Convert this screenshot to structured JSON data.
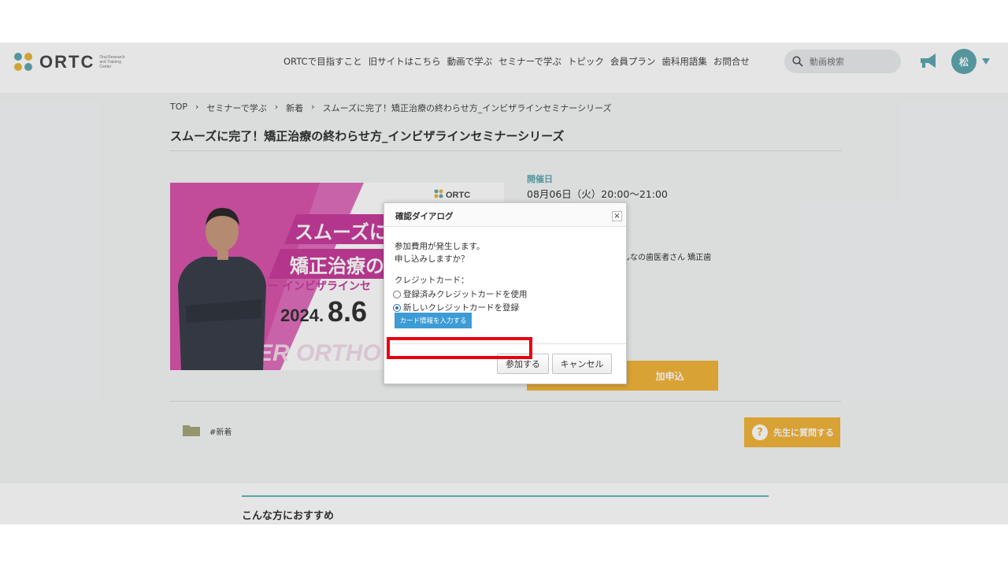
{
  "header": {
    "logo_text": "ORTC",
    "logo_sub": "Oral Research and Training Center",
    "nav": [
      "ORTCで目指すこと",
      "旧サイトはこちら",
      "動画で学ぶ",
      "セミナーで学ぶ",
      "トピック",
      "会員プラン",
      "歯科用語集",
      "お問合せ"
    ],
    "search_placeholder": "動画検索",
    "avatar_initial": "松"
  },
  "breadcrumb": [
    "TOP",
    "›",
    "セミナーで学ぶ",
    "›",
    "新着",
    "›",
    "スムーズに完了！矯正治療の終わらせ方_インビザラインセミナーシリーズ"
  ],
  "page_title": "スムーズに完了！矯正治療の終わらせ方_インビザラインセミナーシリーズ",
  "banner": {
    "line1": "スムーズに",
    "line2": "矯正治療の",
    "line3": "ー インビザラインセ",
    "date": "2024.",
    "date_big": "8.6",
    "logo": "ORTC",
    "watermark": "ER ORTHO"
  },
  "event": {
    "date_label": "開催日",
    "date_value": "08月06日（火）20:00～21:00",
    "desc_fragment": "んなの歯医者さん 矯正歯",
    "apply_label": "加申込"
  },
  "tag": "#新着",
  "ask_button": "先生に質問する",
  "lower_title": "こんな方におすすめ",
  "dialog": {
    "title": "確認ダイアログ",
    "close": "×",
    "message_1": "参加費用が発生します。",
    "message_2": "申し込みしますか？",
    "card_label": "クレジットカード：",
    "option_existing": "登録済みクレジットカードを使用",
    "option_new": "新しいクレジットカードを登録",
    "card_entry_button": "カード情報を入力する",
    "confirm_button": "参加する",
    "cancel_button": "キャンセル"
  },
  "colors": {
    "brand_teal": "#5fa8b0",
    "accent_yellow": "#f2b53a",
    "highlight_red": "#e60012",
    "banner_pink": "#d64aa5"
  }
}
